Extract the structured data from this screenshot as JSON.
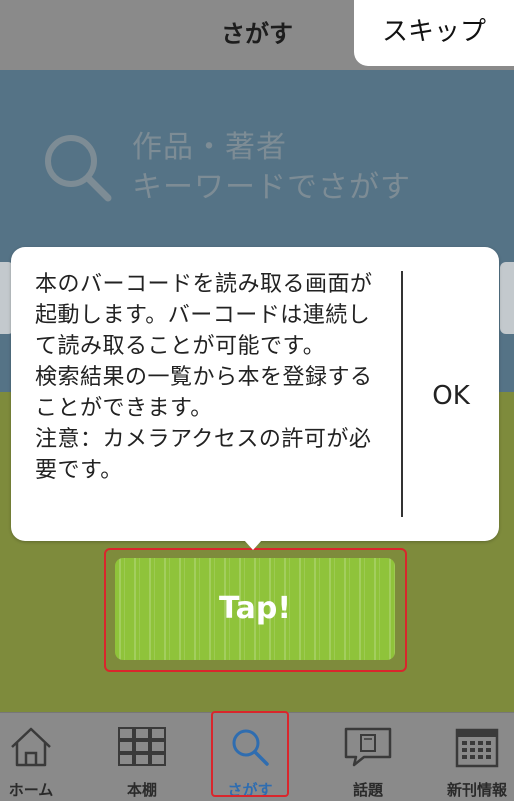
{
  "header": {
    "title": "さがす",
    "skip_label": "スキップ"
  },
  "search": {
    "hint_line1": "作品・著者",
    "hint_line2": "キーワードでさがす"
  },
  "dialog": {
    "message": "本のバーコードを読み取る画面が起動します。バーコードは連続して読み取ることが可能です。\n検索結果の一覧から本を登録することができます。\n注意：カメラアクセスの許可が必要です。",
    "ok_label": "OK"
  },
  "scan_button": {
    "label": "Tap!"
  },
  "tabs": [
    {
      "label": "ホーム",
      "icon": "home-icon",
      "active": false
    },
    {
      "label": "本棚",
      "icon": "bookshelf-icon",
      "active": false
    },
    {
      "label": "さがす",
      "icon": "search-icon",
      "active": true
    },
    {
      "label": "話題",
      "icon": "chat-book-icon",
      "active": false
    },
    {
      "label": "新刊情報",
      "icon": "calendar-icon",
      "active": false
    }
  ],
  "colors": {
    "search_panel": "#557386",
    "green_area": "#7e8b3c",
    "tap_button": "#8fc33a",
    "highlight": "#d9262c",
    "active_tab": "#2f6db0"
  }
}
